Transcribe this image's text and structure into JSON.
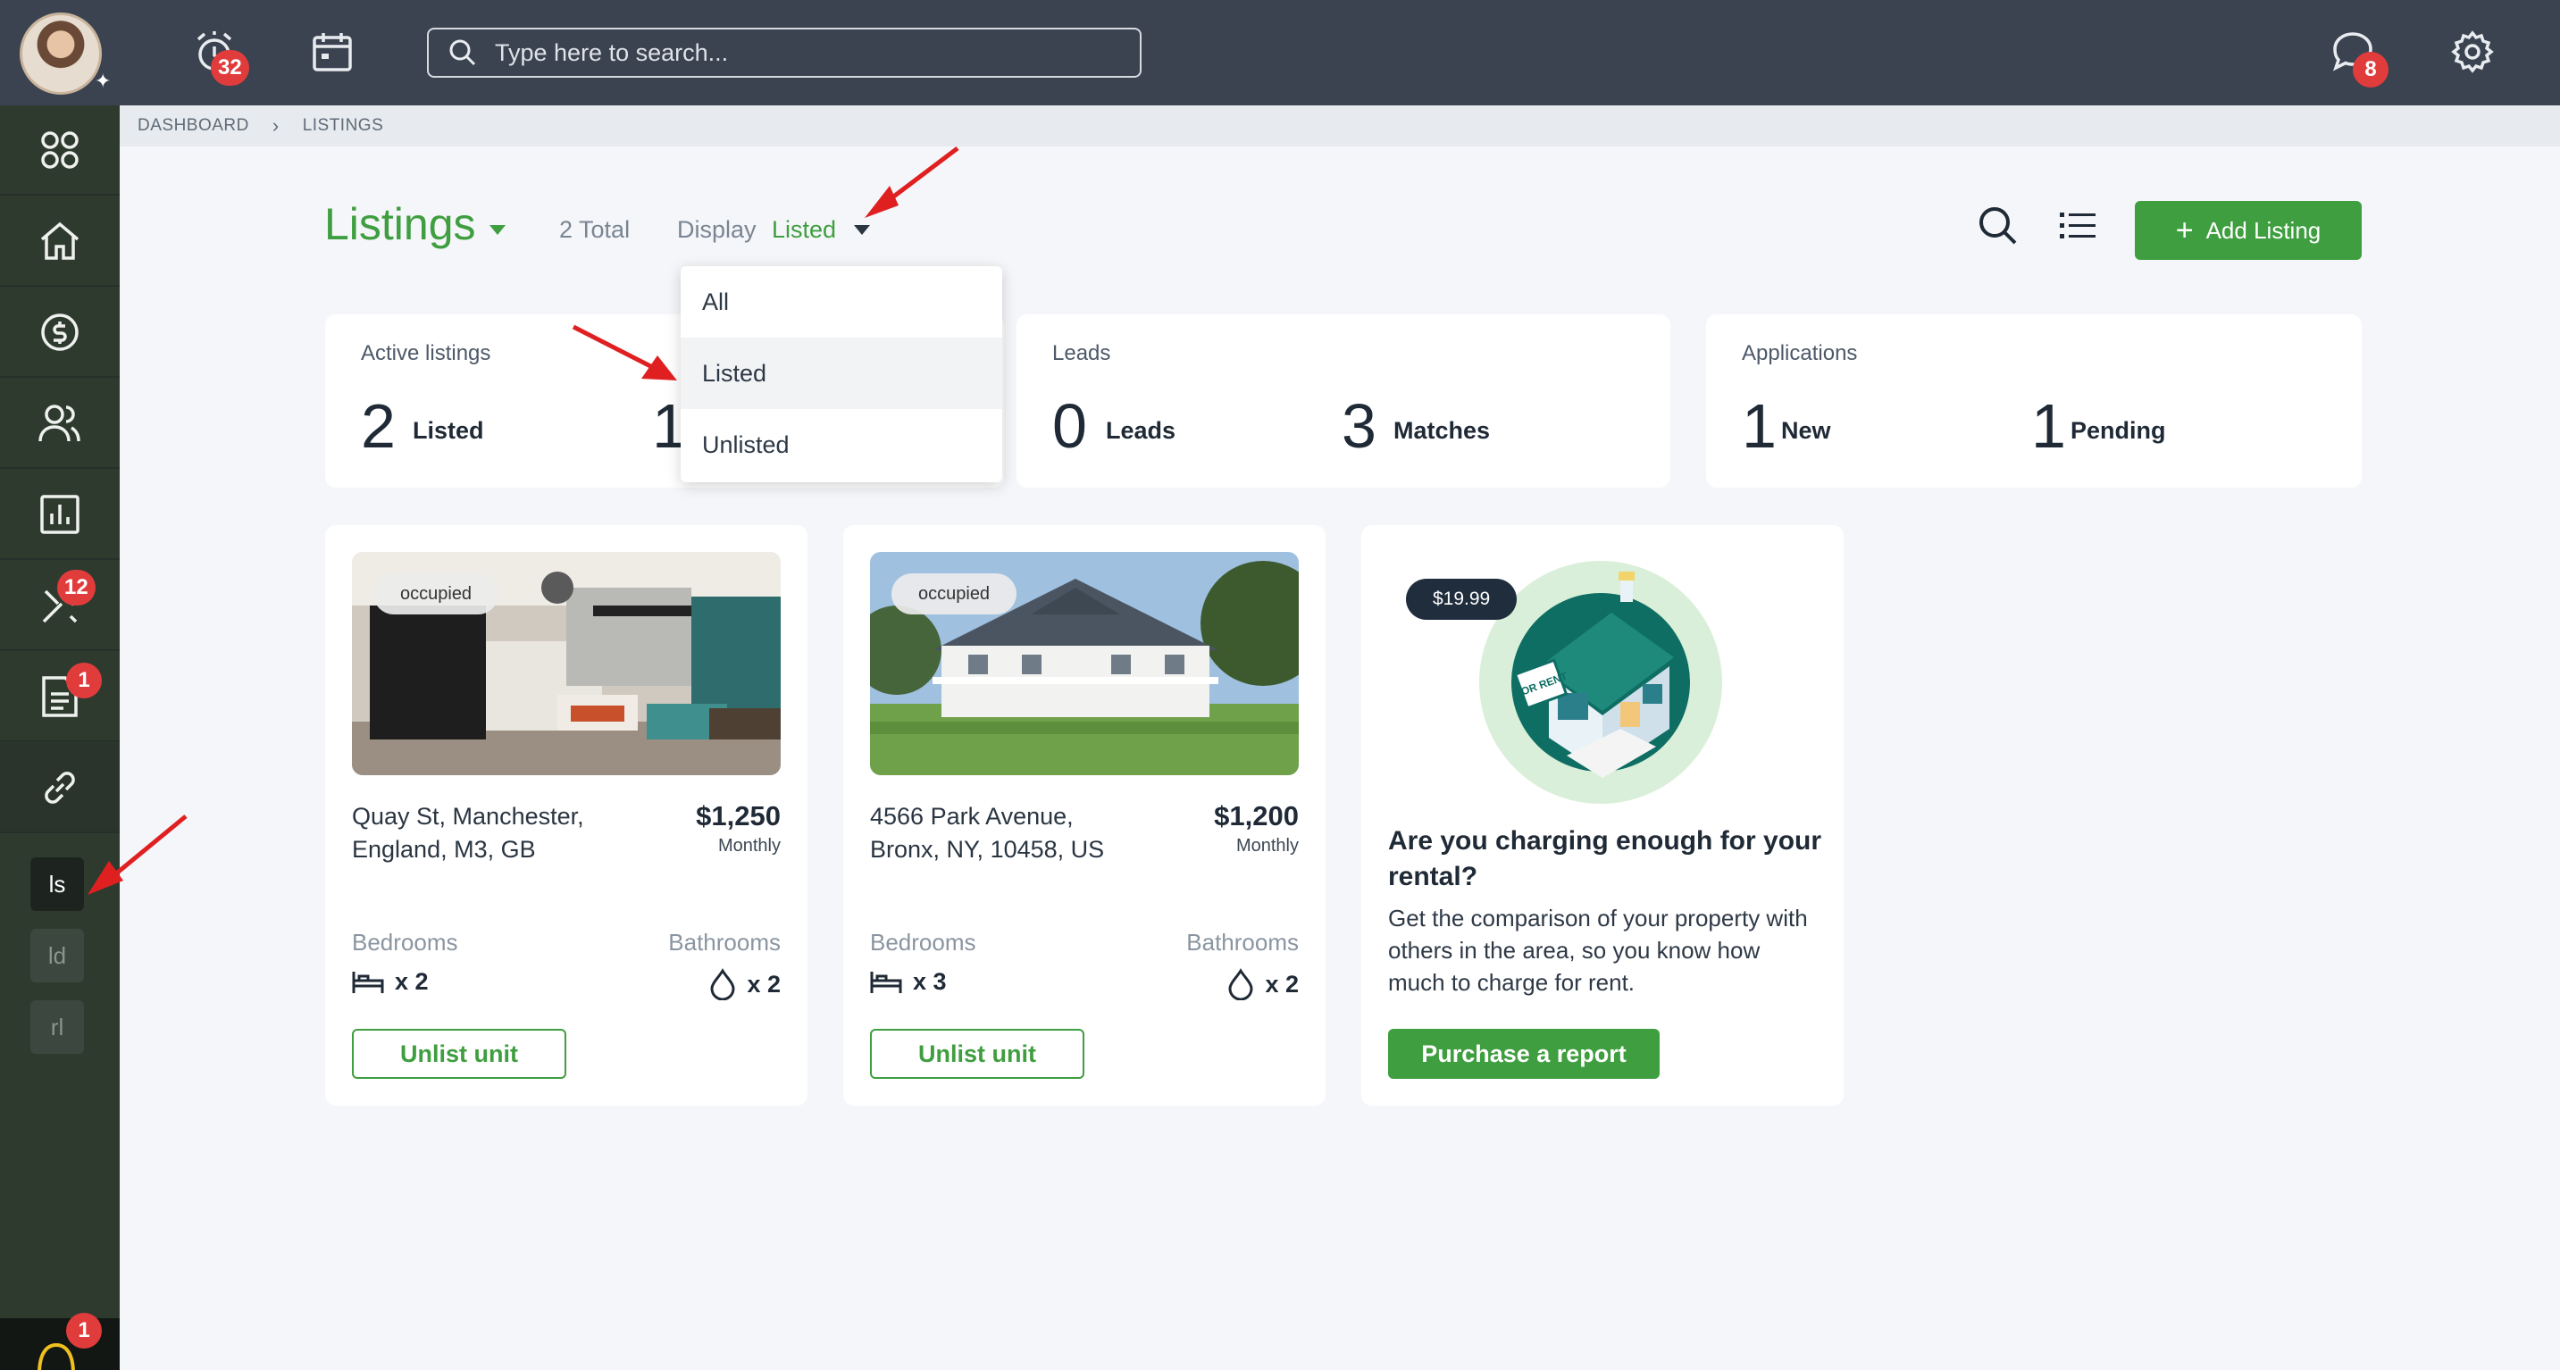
{
  "topbar": {
    "alerts_badge": "32",
    "search_placeholder": "Type here to search...",
    "messages_badge": "8"
  },
  "sidebar": {
    "tools_badge": "12",
    "docs_badge": "1",
    "mini_items": [
      "ls",
      "ld",
      "rl"
    ],
    "bell_badge": "1"
  },
  "breadcrumb": {
    "items": [
      "DASHBOARD",
      "LISTINGS"
    ]
  },
  "header": {
    "title": "Listings",
    "total": "2 Total",
    "display_label": "Display",
    "display_value": "Listed",
    "add_button": "Add Listing"
  },
  "dropdown": {
    "options": [
      "All",
      "Listed",
      "Unlisted"
    ],
    "selected": "Listed"
  },
  "stats": [
    {
      "title": "Active listings",
      "items": [
        {
          "value": "2",
          "label": "Listed"
        },
        {
          "value": "1",
          "label": ""
        }
      ]
    },
    {
      "title": "Leads",
      "items": [
        {
          "value": "0",
          "label": "Leads"
        },
        {
          "value": "3",
          "label": "Matches"
        }
      ]
    },
    {
      "title": "Applications",
      "items": [
        {
          "value": "1",
          "label": "New"
        },
        {
          "value": "1",
          "label": "Pending"
        }
      ]
    }
  ],
  "listings": [
    {
      "status": "occupied",
      "address_line1": "Quay St, Manchester,",
      "address_line2": "England, M3, GB",
      "price": "$1,250",
      "period": "Monthly",
      "bedrooms_label": "Bedrooms",
      "bathrooms_label": "Bathrooms",
      "bedrooms": "x 2",
      "bathrooms": "x 2",
      "action": "Unlist unit"
    },
    {
      "status": "occupied",
      "address_line1": "4566 Park Avenue,",
      "address_line2": "Bronx, NY, 10458, US",
      "price": "$1,200",
      "period": "Monthly",
      "bedrooms_label": "Bedrooms",
      "bathrooms_label": "Bathrooms",
      "bedrooms": "x 3",
      "bathrooms": "x 2",
      "action": "Unlist unit"
    }
  ],
  "promo": {
    "price": "$19.99",
    "sign_text": "FOR RENT",
    "title": "Are you charging enough for your rental?",
    "text": "Get the comparison of your property with others in the area, so you know how much to charge for rent.",
    "button": "Purchase a report"
  },
  "colors": {
    "accent": "#3f9e3f",
    "topbar": "#3b4351",
    "sidebar": "#2f3a2f",
    "badge": "#e13c3c",
    "annotation": "#e02020"
  }
}
